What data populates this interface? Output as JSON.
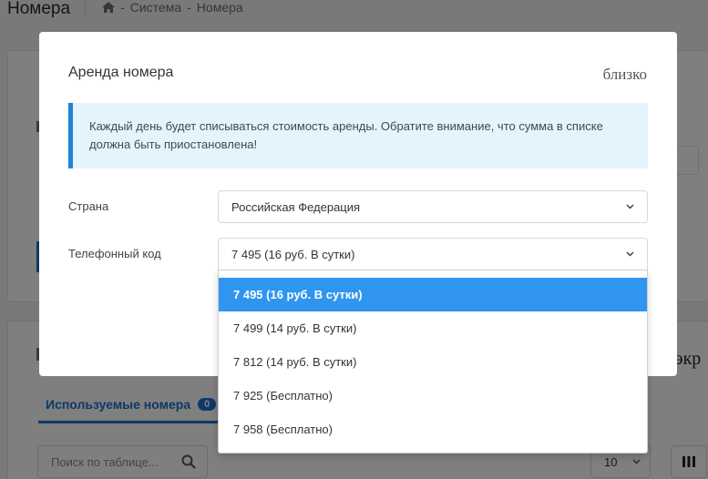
{
  "page": {
    "title": "Номера",
    "breadcrumb": {
      "home_icon": "home-icon",
      "items": [
        "Система",
        "Номера"
      ],
      "separator": "-"
    },
    "partial_text_right": "экр",
    "tabs": [
      {
        "label": "Используемые номера",
        "badge": "0"
      }
    ],
    "search": {
      "placeholder": "Поиск по таблице..."
    },
    "page_size": {
      "value": "10"
    }
  },
  "modal": {
    "title": "Аренда номера",
    "close_label": "близко",
    "alert": "Каждый день будет списываться стоимость аренды. Обратите внимание, что сумма в списке должна быть приостановлена!",
    "country": {
      "label": "Страна",
      "value": "Российская Федерация"
    },
    "phone_code": {
      "label": "Телефонный код",
      "value": "7 495 (16 руб. В сутки)",
      "options": [
        "7 495 (16 руб. В сутки)",
        "7 499 (14 руб. В сутки)",
        "7 812 (14 руб. В сутки)",
        "7 925 (Бесплатно)",
        "7 958 (Бесплатно)"
      ],
      "selected_index": 0
    }
  },
  "colors": {
    "accent": "#1e70cc",
    "selected_option": "#2f95ef",
    "alert_bg": "#e5f3fc",
    "alert_border": "#1e84d6"
  }
}
